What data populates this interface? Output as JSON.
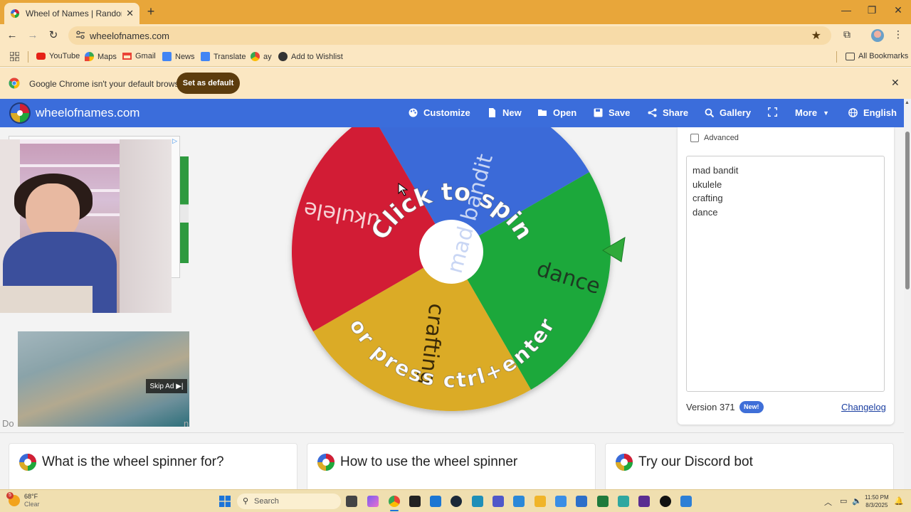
{
  "browser": {
    "tab_title": "Wheel of Names | Random name picker",
    "tab_close": "✕",
    "new_tab": "+",
    "window_controls": {
      "minimize": "—",
      "maximize": "❐",
      "close": "✕"
    },
    "url": "wheelofnames.com",
    "nav": {
      "back": "←",
      "forward": "→",
      "reload": "↻"
    },
    "bookmarks": [
      {
        "label": "YouTube",
        "icon": "youtube-icon"
      },
      {
        "label": "Maps",
        "icon": "maps-icon"
      },
      {
        "label": "Gmail",
        "icon": "gmail-icon"
      },
      {
        "label": "News",
        "icon": "news-icon"
      },
      {
        "label": "Translate",
        "icon": "translate-icon"
      },
      {
        "label": "ay",
        "icon": "chrome-icon"
      },
      {
        "label": "Add to Wishlist",
        "icon": "wishlist-icon"
      }
    ],
    "all_bookmarks": "All Bookmarks",
    "infobar": {
      "message": "Google Chrome isn't your default browser",
      "button": "Set as default",
      "close": "✕"
    }
  },
  "site": {
    "brand": "wheelofnames.com",
    "menu": [
      {
        "label": "Customize",
        "icon": "palette-icon"
      },
      {
        "label": "New",
        "icon": "file-icon"
      },
      {
        "label": "Open",
        "icon": "folder-icon"
      },
      {
        "label": "Save",
        "icon": "save-icon"
      },
      {
        "label": "Share",
        "icon": "share-icon"
      },
      {
        "label": "Gallery",
        "icon": "search-icon"
      },
      {
        "label": "",
        "icon": "fullscreen-icon"
      },
      {
        "label": "More",
        "icon": "chevron-down-icon"
      },
      {
        "label": "English",
        "icon": "globe-icon"
      }
    ],
    "wheel": {
      "top_text": "Click to spin",
      "bottom_text": "or press ctrl+enter",
      "segments": [
        {
          "label": "mad bandit",
          "color": "#3a6bd8"
        },
        {
          "label": "dance",
          "color": "#1fa83a"
        },
        {
          "label": "crafting",
          "color": "#dbab25"
        },
        {
          "label": "ukulele",
          "color": "#d21f34"
        }
      ],
      "pointer_color": "#2faa3a"
    },
    "advanced_label": "Advanced",
    "entries": [
      "mad bandit",
      "ukulele",
      "crafting",
      "dance"
    ],
    "version": "Version 371",
    "new_badge": "New!",
    "changelog": "Changelog",
    "info_cards": [
      "What is the wheel spinner for?",
      "How to use the wheel spinner",
      "Try our Discord bot"
    ]
  },
  "ads": {
    "choices": "▷",
    "skip_ad": "Skip Ad ▶|",
    "partial_left": "Do",
    "partial_right": "n"
  },
  "taskbar": {
    "weather_temp": "68°F",
    "weather_cond": "Clear",
    "weather_badge": "5",
    "search_placeholder": "Search",
    "time": "11:50 PM",
    "date": "8/3/2025"
  }
}
